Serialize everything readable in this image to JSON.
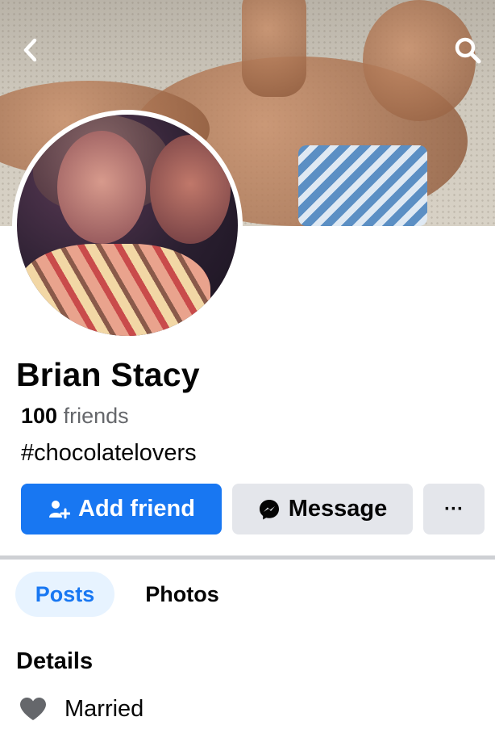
{
  "profile": {
    "name": "Brian Stacy",
    "friends_count": "100",
    "friends_label": "friends",
    "bio": "#chocolatelovers"
  },
  "nav": {
    "back_icon": "chevron-left-icon",
    "search_icon": "search-icon"
  },
  "actions": {
    "add_friend_label": "Add friend",
    "message_label": "Message",
    "more_label": "···"
  },
  "tabs": [
    {
      "label": "Posts",
      "active": true
    },
    {
      "label": "Photos",
      "active": false
    }
  ],
  "details": {
    "title": "Details",
    "items": [
      {
        "icon": "heart-icon",
        "label": "Married"
      }
    ]
  },
  "colors": {
    "accent": "#1877f2",
    "accent_light": "#e7f3ff",
    "button_gray": "#e4e6eb",
    "secondary_text": "#65676b"
  }
}
